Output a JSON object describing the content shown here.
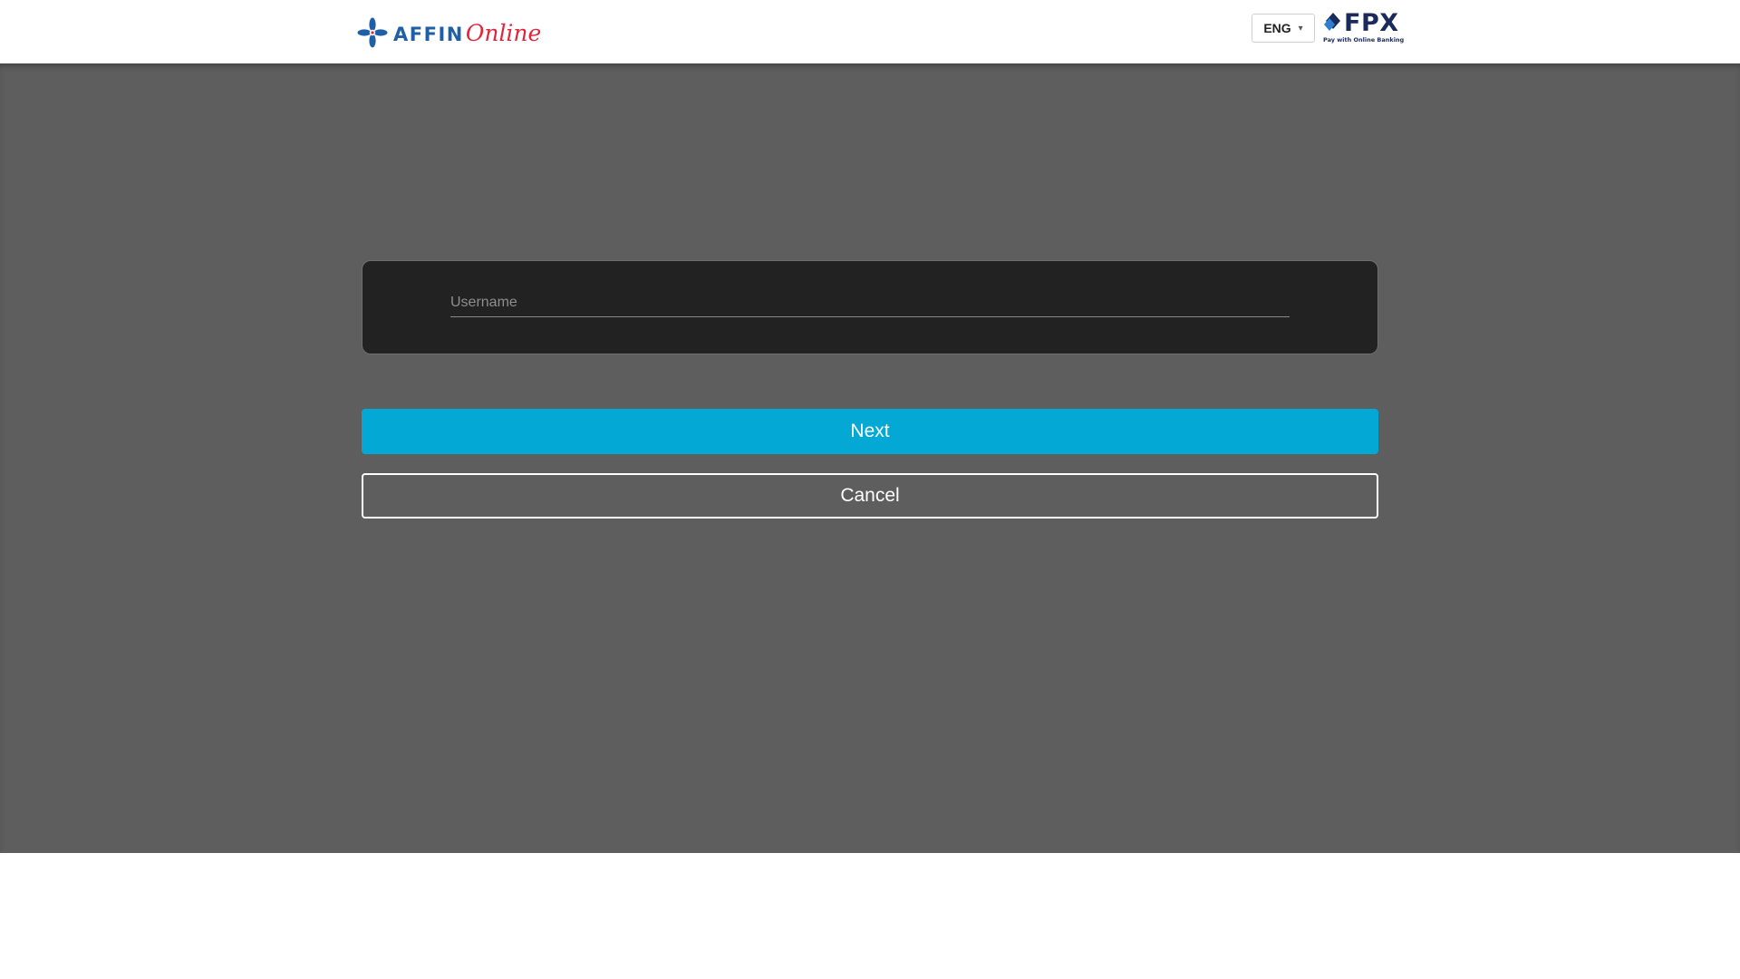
{
  "header": {
    "logo": {
      "brand_part1": "AFFIN",
      "brand_part2": "Online",
      "icon": "affin-flower-icon",
      "colors": {
        "primary": "#1f5fa8",
        "accent": "#e0263a"
      }
    },
    "language": {
      "selected": "ENG",
      "caret_icon": "chevron-down-icon"
    },
    "fpx": {
      "name": "FPX",
      "tagline": "Pay with Online Banking",
      "icon": "fpx-diamond-icon",
      "color": "#1b2a5c"
    }
  },
  "login": {
    "username": {
      "value": "",
      "placeholder": "Username"
    },
    "next_label": "Next",
    "cancel_label": "Cancel"
  },
  "colors": {
    "overlay": "#5e5e5e",
    "card": "#222222",
    "next_button": "#03a9d4",
    "cancel_border": "#ffffff"
  }
}
